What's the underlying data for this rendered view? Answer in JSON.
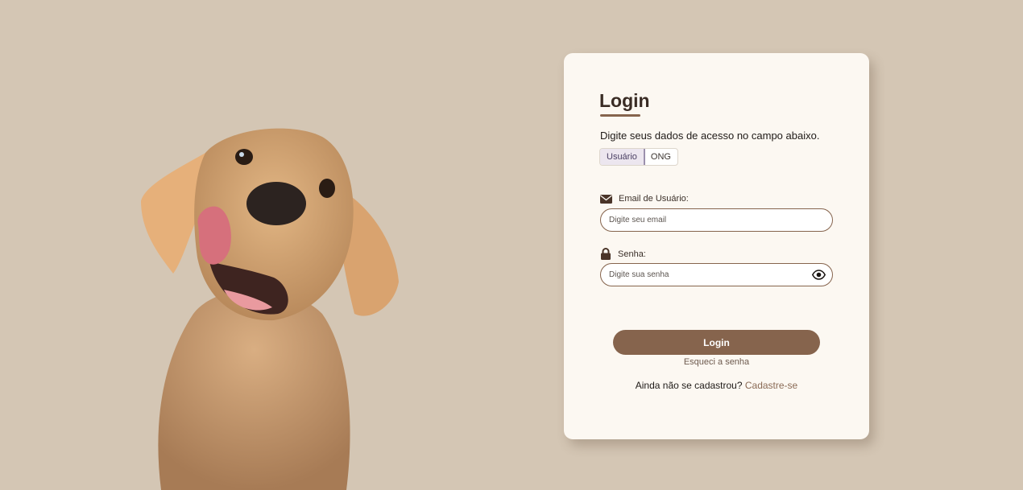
{
  "colors": {
    "background": "#d4c6b4",
    "card": "#fcf8f2",
    "accent": "#86644d",
    "title": "#3a2c25"
  },
  "hero": {
    "image": "puppy-photo"
  },
  "login": {
    "title": "Login",
    "subtitle": "Digite seus dados de acesso no campo abaixo.",
    "toggle": {
      "options": [
        "Usuário",
        "ONG"
      ],
      "selected": "Usuário"
    },
    "email": {
      "label": "Email de Usuário:",
      "placeholder": "Digite seu email",
      "value": "",
      "icon": "envelope-icon"
    },
    "password": {
      "label": "Senha:",
      "placeholder": "Digite sua senha",
      "value": "",
      "icon": "lock-icon",
      "toggle_icon": "eye-icon"
    },
    "submit_label": "Login",
    "forgot_label": "Esqueci a senha",
    "signup_prompt": "Ainda não se cadastrou?",
    "signup_link": "Cadastre-se"
  }
}
